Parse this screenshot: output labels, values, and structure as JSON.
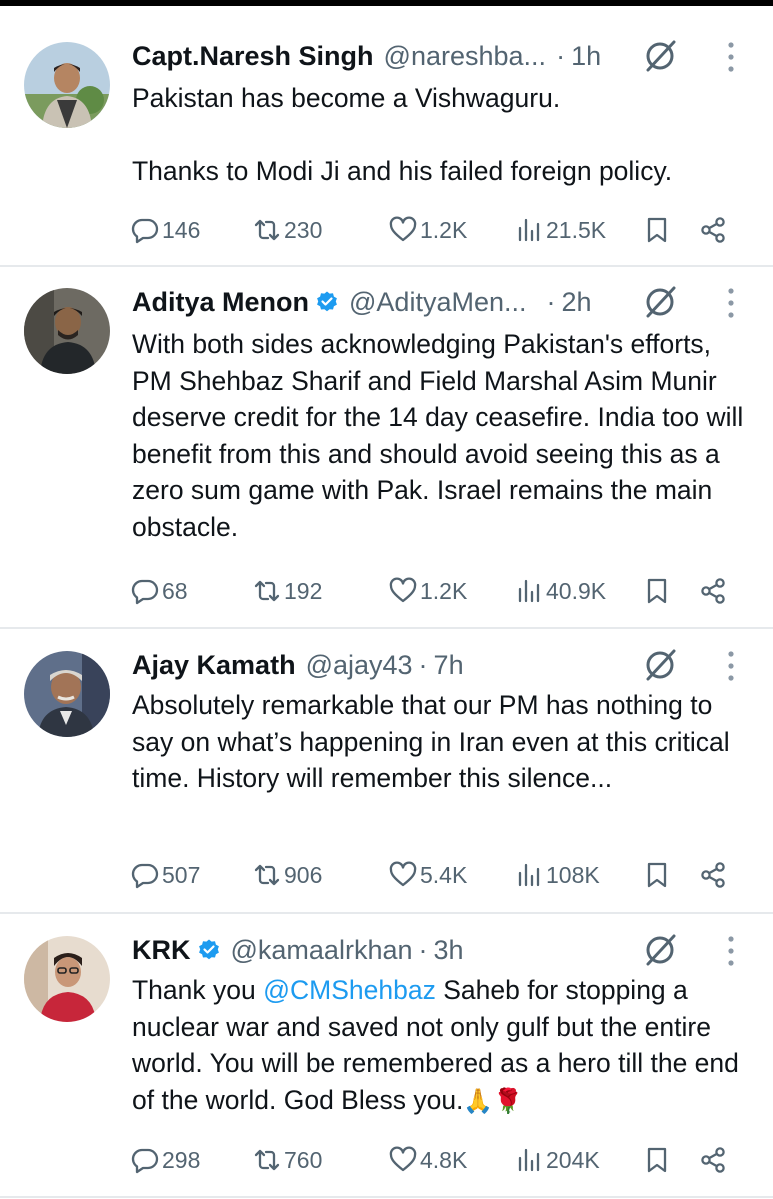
{
  "tweets": [
    {
      "name": "Capt.Naresh Singh",
      "verified": false,
      "handle": "@nareshba...",
      "sep": "·",
      "time": "1h",
      "text": "Pakistan has become a Vishwaguru.\n\nThanks to Modi Ji and his failed foreign policy.",
      "replies": "146",
      "retweets": "230",
      "likes": "1.2K",
      "views": "21.5K"
    },
    {
      "name": "Aditya Menon",
      "verified": true,
      "handle": "@AdityaMen...",
      "sep": "·",
      "time": "2h",
      "text": "With both sides acknowledging Pakistan's efforts, PM Shehbaz Sharif and Field Marshal Asim Munir deserve credit for the 14 day ceasefire. India too will benefit from this and should avoid seeing this as a zero sum game with Pak. Israel remains the main obstacle.",
      "replies": "68",
      "retweets": "192",
      "likes": "1.2K",
      "views": "40.9K"
    },
    {
      "name": "Ajay Kamath",
      "verified": false,
      "handle": "@ajay43",
      "sep": "·",
      "time": "7h",
      "text": "Absolutely remarkable that our PM has nothing to say on what’s happening in Iran even at this critical time. History will remember this silence...",
      "replies": "507",
      "retweets": "906",
      "likes": "5.4K",
      "views": "108K"
    },
    {
      "name": "KRK",
      "verified": true,
      "handle": "@kamaalrkhan",
      "sep": "·",
      "time": "3h",
      "text_before": "Thank you ",
      "mention": "@CMShehbaz",
      "text_after": " Saheb for stopping a nuclear war and saved not only gulf but the entire world. You will be remembered as a hero till the end of the world. God Bless you.",
      "emojis": "🙏🌹",
      "replies": "298",
      "retweets": "760",
      "likes": "4.8K",
      "views": "204K"
    }
  ],
  "colors": {
    "text": "#0f1419",
    "secondary": "#536471",
    "link": "#1d9bf0",
    "verified": "#1d9bf0",
    "divider": "#e6e9ec"
  },
  "icons": [
    "reply-icon",
    "retweet-icon",
    "like-icon",
    "views-icon",
    "bookmark-icon",
    "share-icon",
    "grok-icon",
    "more-icon",
    "verified-badge-icon"
  ]
}
